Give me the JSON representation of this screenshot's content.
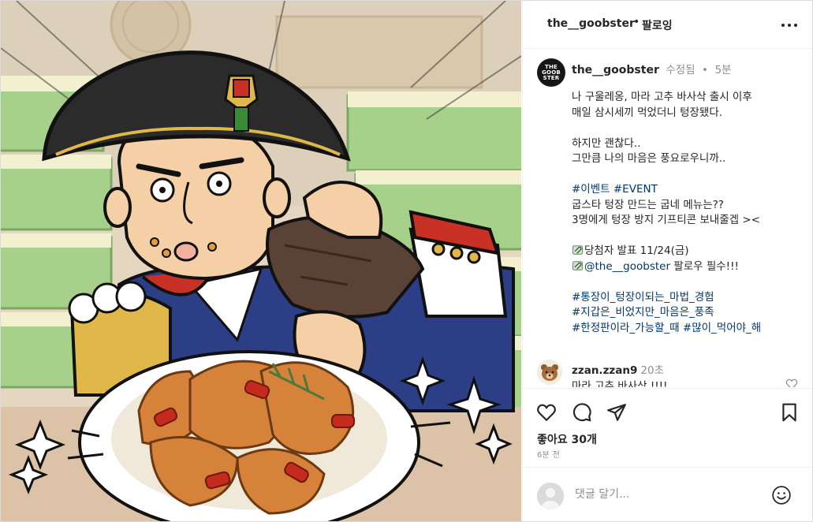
{
  "post": {
    "username": "the__goobster",
    "separator": "•",
    "follow_label": "팔로잉",
    "avatar_text": [
      "THE",
      "GOOB",
      "STER"
    ]
  },
  "caption": {
    "username": "the__goobster",
    "edited": "수정됨",
    "dot": "•",
    "time": "5분",
    "lines": [
      {
        "text": "나 구울레옹, 마라 고추 바사삭 출시 이후"
      },
      {
        "text": "매일 삼시세끼 먹었더니 텅장됐다."
      },
      {
        "text": ""
      },
      {
        "text": "하지만 괜찮다.."
      },
      {
        "text": "그만큼 나의 마음은 풍요로우니까.."
      },
      {
        "text": ""
      },
      {
        "text": "#이벤트 #EVENT",
        "tag": true
      },
      {
        "text": "굽스타 텅장 만드는 굽네 메뉴는??"
      },
      {
        "text": "3명에게 텅장 방지 기프티콘 보내줄겝 ><"
      },
      {
        "text": ""
      },
      {
        "text": "당첨자 발표 11/24(금)",
        "icon": "paperclip-icon"
      },
      {
        "text": "@the__goobster 팔로우 필수!!!",
        "icon": "paperclip-icon",
        "mention": "@the__goobster"
      },
      {
        "text": ""
      },
      {
        "text": "#통장이_텅장이되는_마법_경험",
        "tag": true
      },
      {
        "text": "#지갑은_비었지만_마음은_풍족",
        "tag": true
      },
      {
        "text": "#한정판이라_가능할_때 #많이_먹어야_해",
        "tag": true
      }
    ]
  },
  "comment": {
    "username": "zzan.zzan9",
    "time": "20초",
    "text": "마라 고추 바사삭 !!!!"
  },
  "actions": {
    "icons": [
      "heart-icon",
      "comment-icon",
      "share-icon",
      "bookmark-icon"
    ],
    "likes": "좋아요 30개",
    "time_ago": "6분 전"
  },
  "add_comment": {
    "placeholder": "댓글 달기..."
  },
  "colors": {
    "text": "#262626",
    "muted": "#8e8e8e",
    "link": "#00376b",
    "border": "#dbdbdb"
  }
}
